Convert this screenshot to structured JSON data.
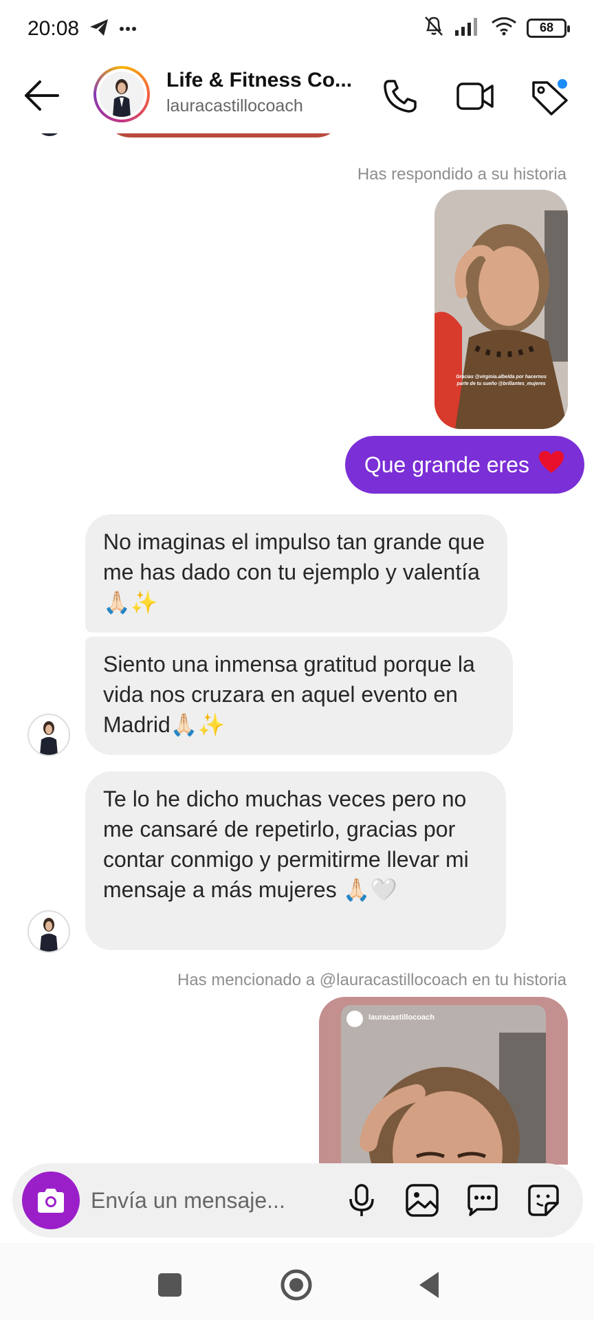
{
  "status": {
    "time": "20:08",
    "battery": "68",
    "icons": [
      "telegram-icon",
      "more-dots-icon",
      "mute-icon",
      "signal-icon",
      "wifi-icon",
      "battery-icon"
    ]
  },
  "header": {
    "title": "Life & Fitness Co...",
    "subtitle": "lauracastillocoach",
    "icons": [
      "back-arrow-icon",
      "phone-icon",
      "video-icon",
      "tag-icon"
    ],
    "tag_dot_color": "#1c8cf7"
  },
  "messages": {
    "story_reply_meta": "Has respondido a su historia",
    "story_caption": "Gracias @virginia.albelda por hacernos parte de tu sueño @brillantes_mujeres",
    "outgoing_text": "Que grande eres",
    "outgoing_emoji": "❤️",
    "incoming": [
      "No imaginas el impulso tan grande que me has dado con tu ejemplo y valentía 🙏🏻✨",
      "Siento una inmensa gratitud porque la vida nos cruzara en aquel evento en Madrid🙏🏻✨",
      "Te lo he dicho muchas veces pero no me cansaré de repetirlo, gracias por contar conmigo y permitirme llevar mi mensaje a más mujeres 🙏🏻🤍"
    ],
    "mention_meta": "Has mencionado a @lauracastillocoach en tu historia",
    "mention_card_user": "lauracastillocoach"
  },
  "composer": {
    "placeholder": "Envía un mensaje...",
    "icons": [
      "camera-icon",
      "microphone-icon",
      "gallery-icon",
      "chat-bubble-icon",
      "sticker-icon"
    ]
  },
  "colors": {
    "outgoing_bubble": "#7b2fd6",
    "incoming_bubble": "#efefef",
    "camera_button": "#9b1fc9"
  }
}
